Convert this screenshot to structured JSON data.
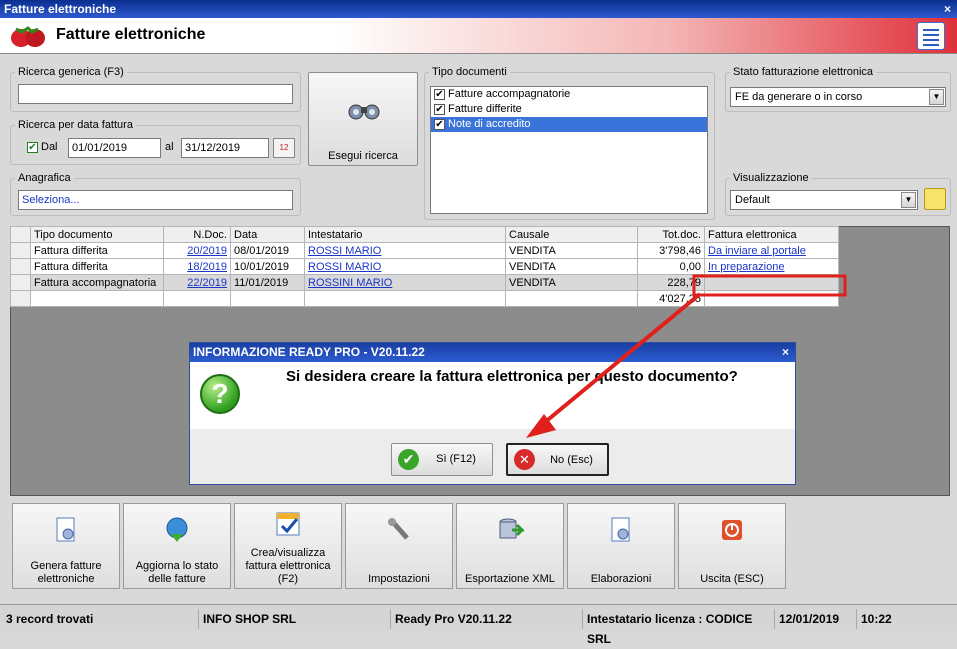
{
  "window": {
    "title": "Fatture elettroniche",
    "close": "×"
  },
  "header": {
    "title": "Fatture elettroniche"
  },
  "search": {
    "generic_legend": "Ricerca generica (F3)",
    "generic_value": "",
    "date_legend": "Ricerca per data fattura",
    "dal_label": "Dal",
    "date_from": "01/01/2019",
    "al_label": "al",
    "date_to": "31/12/2019",
    "calendar_day": "12",
    "anagrafica_legend": "Anagrafica",
    "anagrafica_value": "Seleziona...",
    "execute_label": "Esegui ricerca"
  },
  "tipo_documenti": {
    "legend": "Tipo documenti",
    "items": [
      {
        "label": "Fatture accompagnatorie",
        "checked": "✔"
      },
      {
        "label": "Fatture differite",
        "checked": "✔"
      },
      {
        "label": "Note di accredito",
        "checked": "✔"
      }
    ]
  },
  "stato": {
    "legend": "Stato fatturazione elettronica",
    "value": "FE da generare o in corso"
  },
  "visualizzazione": {
    "legend": "Visualizzazione",
    "value": "Default"
  },
  "grid": {
    "columns": [
      "Tipo documento",
      "N.Doc.",
      "Data",
      "Intestatario",
      "Causale",
      "Tot.doc.",
      "Fattura elettronica"
    ],
    "rows": [
      [
        "Fattura differita",
        "20/2019",
        "08/01/2019",
        "ROSSI MARIO",
        "VENDITA",
        "3'798,46",
        "Da inviare al portale"
      ],
      [
        "Fattura differita",
        "18/2019",
        "10/01/2019",
        "ROSSI MARIO",
        "VENDITA",
        "0,00",
        "In preparazione"
      ],
      [
        "Fattura accompagnatoria",
        "22/2019",
        "11/01/2019",
        "ROSSINI MARIO",
        "VENDITA",
        "228,79",
        ""
      ]
    ],
    "total": "4'027,25"
  },
  "dialog": {
    "title": "INFORMAZIONE READY PRO - V20.11.22",
    "message": "Si desidera creare la fattura elettronica per questo documento?",
    "yes_label": "Sì (F12)",
    "no_label": "No (Esc)"
  },
  "toolbar": [
    {
      "label": "Genera fatture elettroniche"
    },
    {
      "label": "Aggiorna lo stato delle fatture"
    },
    {
      "label": "Crea/visualizza fattura elettronica (F2)"
    },
    {
      "label": "Impostazioni"
    },
    {
      "label": "Esportazione XML"
    },
    {
      "label": "Elaborazioni"
    },
    {
      "label": "Uscita (ESC)"
    }
  ],
  "status": {
    "records": "3 record trovati",
    "company": "INFO SHOP SRL",
    "version": "Ready Pro V20.11.22",
    "license": "Intestatario licenza : CODICE SRL",
    "date": "12/01/2019",
    "time": "10:22"
  },
  "colors": {
    "accent_red": "#e0303a",
    "link_blue": "#1a35c8",
    "annotation_red": "#e0201a"
  }
}
